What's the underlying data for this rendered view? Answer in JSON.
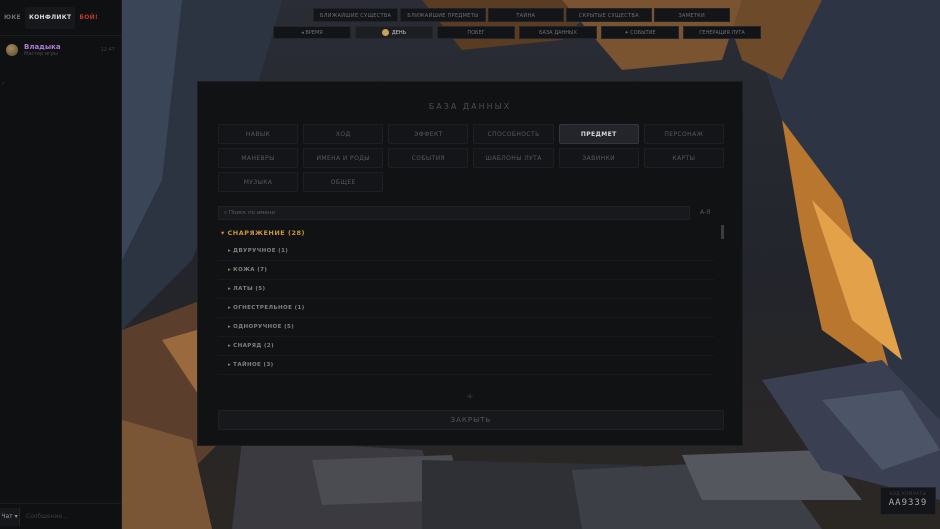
{
  "sidebar": {
    "tabs": [
      {
        "label": "ЮКЕ",
        "state": "normal"
      },
      {
        "label": "КОНФЛИКТ",
        "state": "active"
      },
      {
        "label": "БОЙ!",
        "state": "red"
      }
    ],
    "user": {
      "name": "Владыка",
      "role": "Мастер игры",
      "time": "12:47"
    },
    "select_value": "Чат",
    "message_placeholder": "Сообщение..."
  },
  "topnav": [
    "Ближайшие существа",
    "Ближайшие предметы",
    "Тайна",
    "Скрытые существа",
    "Заметки"
  ],
  "topnav2": [
    {
      "label": "Время",
      "active": false
    },
    {
      "label": "День",
      "active": true
    },
    {
      "label": "Побег",
      "active": false
    },
    {
      "label": "База данных",
      "active": false
    },
    {
      "label": "Событие",
      "active": false
    },
    {
      "label": "Генерация лута",
      "active": false
    }
  ],
  "modal": {
    "title": "БАЗА ДАННЫХ",
    "categories": [
      {
        "label": "НАВЫК",
        "active": false
      },
      {
        "label": "ХОД",
        "active": false
      },
      {
        "label": "ЭФФЕКТ",
        "active": false
      },
      {
        "label": "СПОСОБНОСТЬ",
        "active": false
      },
      {
        "label": "ПРЕДМЕТ",
        "active": true
      },
      {
        "label": "ПЕРСОНАЖ",
        "active": false
      },
      {
        "label": "МАНЕВРЫ",
        "active": false
      },
      {
        "label": "ИМЕНА И РОДЫ",
        "active": false
      },
      {
        "label": "СОБЫТИЯ",
        "active": false
      },
      {
        "label": "ШАБЛОНЫ ЛУТА",
        "active": false
      },
      {
        "label": "ЗАВИНКИ",
        "active": false
      },
      {
        "label": "КАРТЫ",
        "active": false
      },
      {
        "label": "МУЗЫКА",
        "active": false
      },
      {
        "label": "ОБЩЕЕ",
        "active": false
      }
    ],
    "search_placeholder": "⌕ Поиск по имени",
    "sort_label": "А-Я",
    "group": "▾ СНАРЯЖЕНИЕ (28)",
    "rows": [
      "ДВУРУЧНОЕ (1)",
      "КОЖА (7)",
      "ЛАТЫ (5)",
      "ОГНЕСТРЕЛЬНОЕ (1)",
      "ОДНОРУЧНОЕ (5)",
      "СНАРЯД (2)",
      "ТАЙНОЕ (3)"
    ],
    "add_label": "+",
    "close_label": "ЗАКРЫТЬ"
  },
  "badge": {
    "label": "КОД КОМНАТЫ",
    "code": "AA9339"
  },
  "colors": {
    "accent": "#c8943f",
    "user": "#b07bd8",
    "danger": "#c0392b"
  }
}
